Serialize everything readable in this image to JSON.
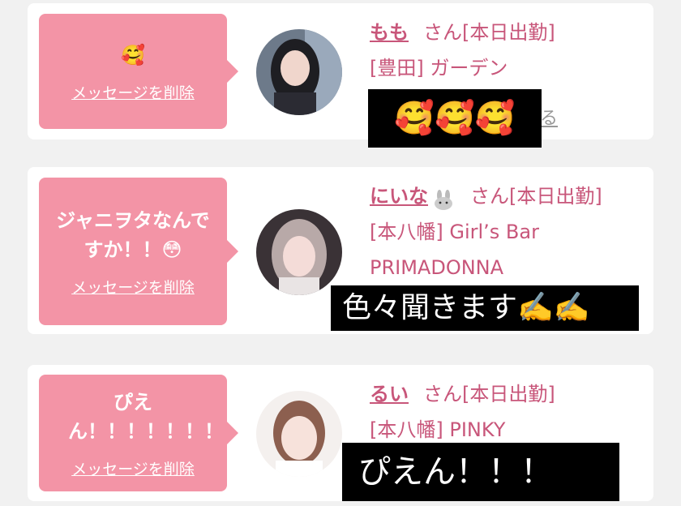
{
  "cards": [
    {
      "message": "🥰",
      "delete_label": "メッセージを削除",
      "name": "もも",
      "san": "さん[本日出勤]",
      "area": "[豊田] ガーデン",
      "shop_line2": "",
      "caption": "🥰🥰🥰",
      "partial_link": "る"
    },
    {
      "message": "ジャニヲタなんですか！！😳",
      "delete_label": "メッセージを削除",
      "name": "にいな",
      "name_icon": "rabbit-icon",
      "san": "さん[本日出勤]",
      "area": "[本八幡] Girl’s Bar",
      "shop_line2": "PRIMADONNA",
      "caption": "色々聞きます✍️✍️"
    },
    {
      "message": "ぴえん！！！！！！！",
      "delete_label": "メッセージを削除",
      "name": "るい",
      "san": "さん[本日出勤]",
      "area": "[本八幡] PINKY",
      "shop_line2": "",
      "caption": "ぴえん！！！"
    }
  ],
  "colors": {
    "bubble": "#f394a6",
    "text_pink": "#c8567a",
    "background": "#f1f1f1"
  }
}
